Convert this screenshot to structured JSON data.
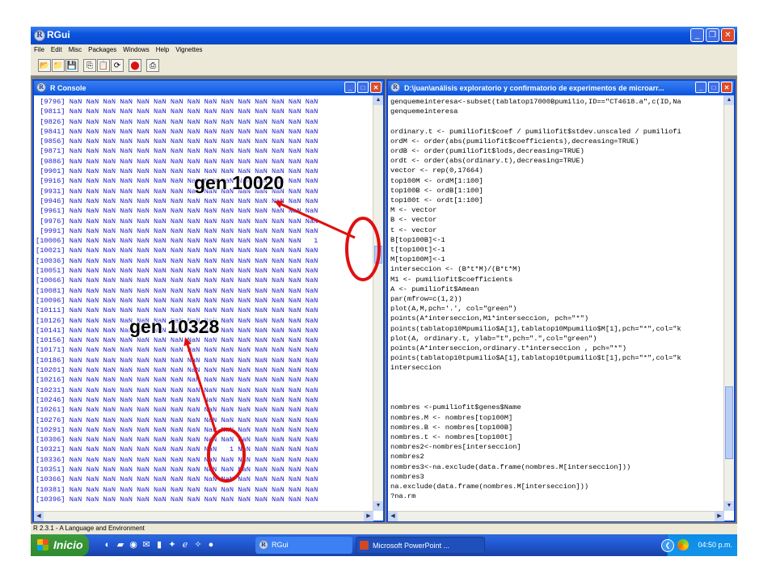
{
  "app": {
    "title": "RGui",
    "status": "R 2.3.1 - A Language and Environment"
  },
  "menu": [
    "File",
    "Edit",
    "Misc",
    "Packages",
    "Windows",
    "Help",
    "Vignettes"
  ],
  "toolbar_icons": [
    "open-script-icon",
    "load-workspace-icon",
    "save-icon",
    "copy-icon",
    "paste-icon",
    "copy-paste-icon",
    "stop-icon",
    "print-icon"
  ],
  "console": {
    "title": "R Console",
    "rows": [
      {
        "index": "[9796]",
        "values": [
          "NaN",
          "NaN",
          "NaN",
          "NaN",
          "NaN",
          "NaN",
          "NaN",
          "NaN",
          "NaN",
          "NaN",
          "NaN",
          "NaN",
          "NaN",
          "NaN",
          "NaN"
        ]
      },
      {
        "index": "[9811]",
        "values": [
          "NaN",
          "NaN",
          "NaN",
          "NaN",
          "NaN",
          "NaN",
          "NaN",
          "NaN",
          "NaN",
          "NaN",
          "NaN",
          "NaN",
          "NaN",
          "NaN",
          "NaN"
        ]
      },
      {
        "index": "[9826]",
        "values": [
          "NaN",
          "NaN",
          "NaN",
          "NaN",
          "NaN",
          "NaN",
          "NaN",
          "NaN",
          "NaN",
          "NaN",
          "NaN",
          "NaN",
          "NaN",
          "NaN",
          "NaN"
        ]
      },
      {
        "index": "[9841]",
        "values": [
          "NaN",
          "NaN",
          "NaN",
          "NaN",
          "NaN",
          "NaN",
          "NaN",
          "NaN",
          "NaN",
          "NaN",
          "NaN",
          "NaN",
          "NaN",
          "NaN",
          "NaN"
        ]
      },
      {
        "index": "[9856]",
        "values": [
          "NaN",
          "NaN",
          "NaN",
          "NaN",
          "NaN",
          "NaN",
          "NaN",
          "NaN",
          "NaN",
          "NaN",
          "NaN",
          "NaN",
          "NaN",
          "NaN",
          "NaN"
        ]
      },
      {
        "index": "[9871]",
        "values": [
          "NaN",
          "NaN",
          "NaN",
          "NaN",
          "NaN",
          "NaN",
          "NaN",
          "NaN",
          "NaN",
          "NaN",
          "NaN",
          "NaN",
          "NaN",
          "NaN",
          "NaN"
        ]
      },
      {
        "index": "[9886]",
        "values": [
          "NaN",
          "NaN",
          "NaN",
          "NaN",
          "NaN",
          "NaN",
          "NaN",
          "NaN",
          "NaN",
          "NaN",
          "NaN",
          "NaN",
          "NaN",
          "NaN",
          "NaN"
        ]
      },
      {
        "index": "[9901]",
        "values": [
          "NaN",
          "NaN",
          "NaN",
          "NaN",
          "NaN",
          "NaN",
          "NaN",
          "NaN",
          "NaN",
          "NaN",
          "NaN",
          "NaN",
          "NaN",
          "NaN",
          "NaN"
        ]
      },
      {
        "index": "[9916]",
        "values": [
          "NaN",
          "NaN",
          "NaN",
          "NaN",
          "NaN",
          "NaN",
          "NaN",
          "NaN",
          "NaN",
          "NaN",
          "NaN",
          "NaN",
          "NaN",
          "NaN",
          "NaN"
        ]
      },
      {
        "index": "[9931]",
        "values": [
          "NaN",
          "NaN",
          "NaN",
          "NaN",
          "NaN",
          "NaN",
          "NaN",
          "NaN",
          "NaN",
          "NaN",
          "NaN",
          "NaN",
          "NaN",
          "NaN",
          "NaN"
        ]
      },
      {
        "index": "[9946]",
        "values": [
          "NaN",
          "NaN",
          "NaN",
          "NaN",
          "NaN",
          "NaN",
          "NaN",
          "NaN",
          "NaN",
          "NaN",
          "NaN",
          "NaN",
          "NaN",
          "NaN",
          "NaN"
        ]
      },
      {
        "index": "[9961]",
        "values": [
          "NaN",
          "NaN",
          "NaN",
          "NaN",
          "NaN",
          "NaN",
          "NaN",
          "NaN",
          "NaN",
          "NaN",
          "NaN",
          "NaN",
          "NaN",
          "NaN",
          "NaN"
        ]
      },
      {
        "index": "[9976]",
        "values": [
          "NaN",
          "NaN",
          "NaN",
          "NaN",
          "NaN",
          "NaN",
          "NaN",
          "NaN",
          "NaN",
          "NaN",
          "NaN",
          "NaN",
          "NaN",
          "NaN",
          "NaN"
        ]
      },
      {
        "index": "[9991]",
        "values": [
          "NaN",
          "NaN",
          "NaN",
          "NaN",
          "NaN",
          "NaN",
          "NaN",
          "NaN",
          "NaN",
          "NaN",
          "NaN",
          "NaN",
          "NaN",
          "NaN",
          "NaN"
        ]
      },
      {
        "index": "[10006]",
        "values": [
          "NaN",
          "NaN",
          "NaN",
          "NaN",
          "NaN",
          "NaN",
          "NaN",
          "NaN",
          "NaN",
          "NaN",
          "NaN",
          "NaN",
          "NaN",
          "NaN",
          "1"
        ]
      },
      {
        "index": "[10021]",
        "values": [
          "NaN",
          "NaN",
          "NaN",
          "NaN",
          "NaN",
          "NaN",
          "NaN",
          "NaN",
          "NaN",
          "NaN",
          "NaN",
          "NaN",
          "NaN",
          "NaN",
          "NaN"
        ]
      },
      {
        "index": "[10036]",
        "values": [
          "NaN",
          "NaN",
          "NaN",
          "NaN",
          "NaN",
          "NaN",
          "NaN",
          "NaN",
          "NaN",
          "NaN",
          "NaN",
          "NaN",
          "NaN",
          "NaN",
          "NaN"
        ]
      },
      {
        "index": "[10051]",
        "values": [
          "NaN",
          "NaN",
          "NaN",
          "NaN",
          "NaN",
          "NaN",
          "NaN",
          "NaN",
          "NaN",
          "NaN",
          "NaN",
          "NaN",
          "NaN",
          "NaN",
          "NaN"
        ]
      },
      {
        "index": "[10066]",
        "values": [
          "NaN",
          "NaN",
          "NaN",
          "NaN",
          "NaN",
          "NaN",
          "NaN",
          "NaN",
          "NaN",
          "NaN",
          "NaN",
          "NaN",
          "NaN",
          "NaN",
          "NaN"
        ]
      },
      {
        "index": "[10081]",
        "values": [
          "NaN",
          "NaN",
          "NaN",
          "NaN",
          "NaN",
          "NaN",
          "NaN",
          "NaN",
          "NaN",
          "NaN",
          "NaN",
          "NaN",
          "NaN",
          "NaN",
          "NaN"
        ]
      },
      {
        "index": "[10096]",
        "values": [
          "NaN",
          "NaN",
          "NaN",
          "NaN",
          "NaN",
          "NaN",
          "NaN",
          "NaN",
          "NaN",
          "NaN",
          "NaN",
          "NaN",
          "NaN",
          "NaN",
          "NaN"
        ]
      },
      {
        "index": "[10111]",
        "values": [
          "NaN",
          "NaN",
          "NaN",
          "NaN",
          "NaN",
          "NaN",
          "NaN",
          "NaN",
          "NaN",
          "NaN",
          "NaN",
          "NaN",
          "NaN",
          "NaN",
          "NaN"
        ]
      },
      {
        "index": "[10126]",
        "values": [
          "NaN",
          "NaN",
          "NaN",
          "NaN",
          "NaN",
          "NaN",
          "NaN",
          "NaN",
          "NaN",
          "NaN",
          "NaN",
          "NaN",
          "NaN",
          "NaN",
          "NaN"
        ]
      },
      {
        "index": "[10141]",
        "values": [
          "NaN",
          "NaN",
          "NaN",
          "NaN",
          "NaN",
          "NaN",
          "NaN",
          "NaN",
          "NaN",
          "NaN",
          "NaN",
          "NaN",
          "NaN",
          "NaN",
          "NaN"
        ]
      },
      {
        "index": "[10156]",
        "values": [
          "NaN",
          "NaN",
          "NaN",
          "NaN",
          "NaN",
          "NaN",
          "NaN",
          "NaN",
          "NaN",
          "NaN",
          "NaN",
          "NaN",
          "NaN",
          "NaN",
          "NaN"
        ]
      },
      {
        "index": "[10171]",
        "values": [
          "NaN",
          "NaN",
          "NaN",
          "NaN",
          "NaN",
          "NaN",
          "NaN",
          "NaN",
          "NaN",
          "NaN",
          "NaN",
          "NaN",
          "NaN",
          "NaN",
          "NaN"
        ]
      },
      {
        "index": "[10186]",
        "values": [
          "NaN",
          "NaN",
          "NaN",
          "NaN",
          "NaN",
          "NaN",
          "NaN",
          "NaN",
          "NaN",
          "NaN",
          "NaN",
          "NaN",
          "NaN",
          "NaN",
          "NaN"
        ]
      },
      {
        "index": "[10201]",
        "values": [
          "NaN",
          "NaN",
          "NaN",
          "NaN",
          "NaN",
          "NaN",
          "NaN",
          "NaN",
          "NaN",
          "NaN",
          "NaN",
          "NaN",
          "NaN",
          "NaN",
          "NaN"
        ]
      },
      {
        "index": "[10216]",
        "values": [
          "NaN",
          "NaN",
          "NaN",
          "NaN",
          "NaN",
          "NaN",
          "NaN",
          "NaN",
          "NaN",
          "NaN",
          "NaN",
          "NaN",
          "NaN",
          "NaN",
          "NaN"
        ]
      },
      {
        "index": "[10231]",
        "values": [
          "NaN",
          "NaN",
          "NaN",
          "NaN",
          "NaN",
          "NaN",
          "NaN",
          "NaN",
          "NaN",
          "NaN",
          "NaN",
          "NaN",
          "NaN",
          "NaN",
          "NaN"
        ]
      },
      {
        "index": "[10246]",
        "values": [
          "NaN",
          "NaN",
          "NaN",
          "NaN",
          "NaN",
          "NaN",
          "NaN",
          "NaN",
          "NaN",
          "NaN",
          "NaN",
          "NaN",
          "NaN",
          "NaN",
          "NaN"
        ]
      },
      {
        "index": "[10261]",
        "values": [
          "NaN",
          "NaN",
          "NaN",
          "NaN",
          "NaN",
          "NaN",
          "NaN",
          "NaN",
          "NaN",
          "NaN",
          "NaN",
          "NaN",
          "NaN",
          "NaN",
          "NaN"
        ]
      },
      {
        "index": "[10276]",
        "values": [
          "NaN",
          "NaN",
          "NaN",
          "NaN",
          "NaN",
          "NaN",
          "NaN",
          "NaN",
          "NaN",
          "NaN",
          "NaN",
          "NaN",
          "NaN",
          "NaN",
          "NaN"
        ]
      },
      {
        "index": "[10291]",
        "values": [
          "NaN",
          "NaN",
          "NaN",
          "NaN",
          "NaN",
          "NaN",
          "NaN",
          "NaN",
          "NaN",
          "NaN",
          "NaN",
          "NaN",
          "NaN",
          "NaN",
          "NaN"
        ]
      },
      {
        "index": "[10306]",
        "values": [
          "NaN",
          "NaN",
          "NaN",
          "NaN",
          "NaN",
          "NaN",
          "NaN",
          "NaN",
          "NaN",
          "NaN",
          "NaN",
          "NaN",
          "NaN",
          "NaN",
          "NaN"
        ]
      },
      {
        "index": "[10321]",
        "values": [
          "NaN",
          "NaN",
          "NaN",
          "NaN",
          "NaN",
          "NaN",
          "NaN",
          "NaN",
          "NaN",
          "1",
          "NaN",
          "NaN",
          "NaN",
          "NaN",
          "NaN"
        ]
      },
      {
        "index": "[10336]",
        "values": [
          "NaN",
          "NaN",
          "NaN",
          "NaN",
          "NaN",
          "NaN",
          "NaN",
          "NaN",
          "NaN",
          "NaN",
          "NaN",
          "NaN",
          "NaN",
          "NaN",
          "NaN"
        ]
      },
      {
        "index": "[10351]",
        "values": [
          "NaN",
          "NaN",
          "NaN",
          "NaN",
          "NaN",
          "NaN",
          "NaN",
          "NaN",
          "NaN",
          "NaN",
          "NaN",
          "NaN",
          "NaN",
          "NaN",
          "NaN"
        ]
      },
      {
        "index": "[10366]",
        "values": [
          "NaN",
          "NaN",
          "NaN",
          "NaN",
          "NaN",
          "NaN",
          "NaN",
          "NaN",
          "NaN",
          "NaN",
          "NaN",
          "NaN",
          "NaN",
          "NaN",
          "NaN"
        ]
      },
      {
        "index": "[10381]",
        "values": [
          "NaN",
          "NaN",
          "NaN",
          "NaN",
          "NaN",
          "NaN",
          "NaN",
          "NaN",
          "NaN",
          "NaN",
          "NaN",
          "NaN",
          "NaN",
          "NaN",
          "NaN"
        ]
      },
      {
        "index": "[10396]",
        "values": [
          "NaN",
          "NaN",
          "NaN",
          "NaN",
          "NaN",
          "NaN",
          "NaN",
          "NaN",
          "NaN",
          "NaN",
          "NaN",
          "NaN",
          "NaN",
          "NaN",
          "NaN"
        ]
      }
    ]
  },
  "script_editor": {
    "title": "D:\\juan\\análisis exploratorio y confirmatorio de experimentos de microarr...",
    "lines": [
      "genquemeinteresa<-subset(tablatop17000Bpumilio,ID==\"CT4618.a\",c(ID,Na",
      "genquemeinteresa",
      "",
      "ordinary.t <- pumiliofit$coef / pumiliofit$stdev.unscaled / pumiliofi",
      "ordM <- order(abs(pumiliofit$coefficients),decreasing=TRUE)",
      "ordB <- order(pumiliofit$lods,decreasing=TRUE)",
      "ordt <- order(abs(ordinary.t),decreasing=TRUE)",
      "vector <- rep(0,17664)",
      "top100M <- ordM[1:100]",
      "top100B <- ordB[1:100]",
      "top100t <- ordt[1:100]",
      "M <- vector",
      "B <- vector",
      "t <- vector",
      "B[top100B]<-1",
      "t[top100t]<-1",
      "M[top100M]<-1",
      "interseccion <- (B*t*M)/(B*t*M)",
      "M1 <- pumiliofit$coefficients",
      "A <- pumiliofit$Amean",
      "par(mfrow=c(1,2))",
      "plot(A,M,pch='.', col=\"green\")",
      "points(A*interseccion,M1*interseccion, pch=\"*\")",
      "points(tablatop10Mpumilio$A[1],tablatop10Mpumilio$M[1],pch=\"*\",col=\"k",
      "plot(A, ordinary.t, ylab=\"t\",pch=\".\",col=\"green\")",
      "points(A*interseccion,ordinary.t*interseccion , pch=\"*\")",
      "points(tablatop10tpumilio$A[1],tablatop10tpumilio$t[1],pch=\"*\",col=\"k",
      "interseccion",
      "",
      "",
      "",
      "nombres <-pumiliofit$genes$Name",
      "nombres.M <- nombres[top100M]",
      "nombres.B <- nombres[top100B]",
      "nombres.t <- nombres[top100t]",
      "nombres2<-nombres[interseccion]",
      "nombres2",
      "nombres3<-na.exclude(data.frame(nombres.M[interseccion]))",
      "nombres3",
      "na.exclude(data.frame(nombres.M[interseccion]))",
      "?na.rm"
    ]
  },
  "annotations": {
    "gen_a": "gen 10020",
    "gen_b": "gen 10328"
  },
  "taskbar": {
    "start_label": "Inicio",
    "tasks": [
      {
        "label": "RGui"
      },
      {
        "label": "Microsoft PowerPoint ..."
      }
    ],
    "clock": "04:50 p.m."
  },
  "colors": {
    "titlebar_blue": "#0a55e0",
    "console_text": "#1a1acc",
    "annotation_red": "#e01010",
    "taskbar_blue": "#245edb",
    "start_green": "#3c9a3c"
  }
}
